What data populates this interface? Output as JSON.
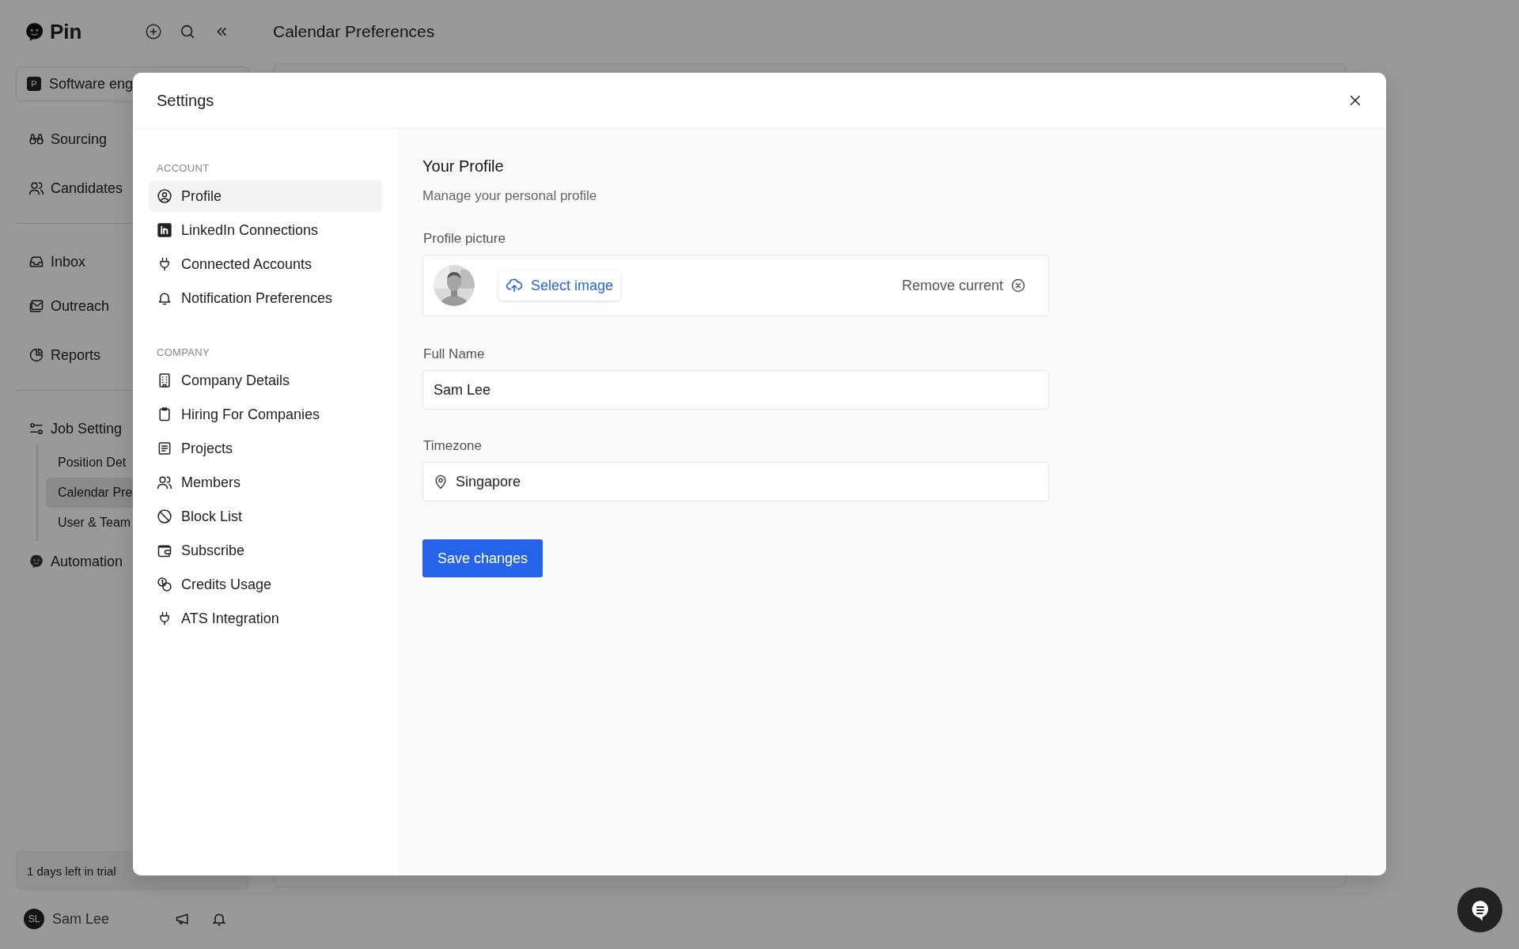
{
  "app": {
    "logo": "Pin",
    "page_title": "Calendar Preferences",
    "workspace": {
      "badge": "P",
      "name": "Software eng"
    },
    "nav_groups": [
      [
        "Sourcing",
        "Candidates"
      ],
      [
        "Inbox",
        "Outreach",
        "Reports"
      ]
    ],
    "job_settings": {
      "label": "Job Setting",
      "children": [
        {
          "label": "Position Det",
          "selected": false
        },
        {
          "label": "Calendar Pre",
          "selected": true
        },
        {
          "label": "User & Team",
          "selected": false
        }
      ]
    },
    "automation": "Automation",
    "trial": {
      "text": "1 days left in trial"
    },
    "user": {
      "initials": "SL",
      "name": "Sam Lee"
    }
  },
  "settings": {
    "title": "Settings",
    "sections": [
      {
        "heading": "ACCOUNT",
        "items": [
          {
            "label": "Profile",
            "selected": true
          },
          {
            "label": "LinkedIn Connections",
            "selected": false
          },
          {
            "label": "Connected Accounts",
            "selected": false
          },
          {
            "label": "Notification Preferences",
            "selected": false
          }
        ]
      },
      {
        "heading": "COMPANY",
        "items": [
          {
            "label": "Company Details",
            "selected": false
          },
          {
            "label": "Hiring For Companies",
            "selected": false
          },
          {
            "label": "Projects",
            "selected": false
          },
          {
            "label": "Members",
            "selected": false
          },
          {
            "label": "Block List",
            "selected": false
          },
          {
            "label": "Subscribe",
            "selected": false
          },
          {
            "label": "Credits Usage",
            "selected": false
          },
          {
            "label": "ATS Integration",
            "selected": false
          }
        ]
      }
    ],
    "profile": {
      "title": "Your Profile",
      "subtitle": "Manage your personal profile",
      "picture_label": "Profile picture",
      "select_image": "Select image",
      "remove_current": "Remove current",
      "full_name": {
        "label": "Full Name",
        "value": "Sam Lee"
      },
      "timezone": {
        "label": "Timezone",
        "value": "Singapore"
      },
      "save": "Save changes"
    }
  }
}
